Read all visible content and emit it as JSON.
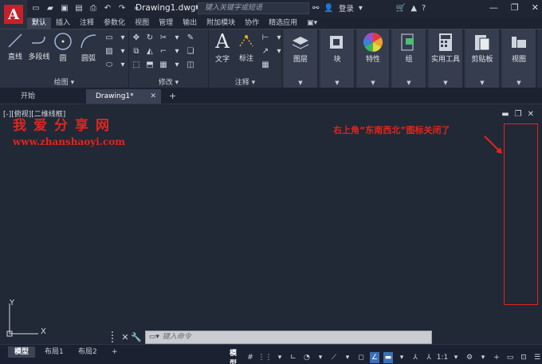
{
  "app": {
    "logo_letter": "A",
    "doc_title": "Drawing1.dwg",
    "search_placeholder": "键入关键字或短语",
    "login_label": "登录"
  },
  "ribbon_tabs": [
    "默认",
    "插入",
    "注释",
    "参数化",
    "视图",
    "管理",
    "输出",
    "附加模块",
    "协作",
    "精选应用"
  ],
  "ribbon": {
    "draw_tools": {
      "line": "直线",
      "polyline": "多段线",
      "circle": "圆",
      "arc": "圆弧"
    },
    "draw_label": "绘图",
    "modify_label": "修改",
    "annotation_tools": {
      "text": "文字",
      "dimension": "标注"
    },
    "annotation_label": "注释",
    "big_panels": [
      "图层",
      "块",
      "特性",
      "组",
      "实用工具",
      "剪贴板",
      "视图"
    ]
  },
  "file_tabs": {
    "start": "开始",
    "drawing": "Drawing1*"
  },
  "viewport": {
    "label": "[-][俯视][二维线框]",
    "watermark_title": "我爱分享网",
    "watermark_url": "www.zhanshaoyi.com",
    "annotation": "右上角“东南西北”图标关闭了",
    "ucs_x": "X",
    "ucs_y": "Y"
  },
  "command": {
    "placeholder": "键入命令"
  },
  "layout_tabs": [
    "模型",
    "布局1",
    "布局2"
  ],
  "status": {
    "model": "模型",
    "scale": "1:1"
  },
  "colors": {
    "accent_red": "#e0261e",
    "brand_red": "#c8202a",
    "active_blue": "#3a6fb5"
  }
}
